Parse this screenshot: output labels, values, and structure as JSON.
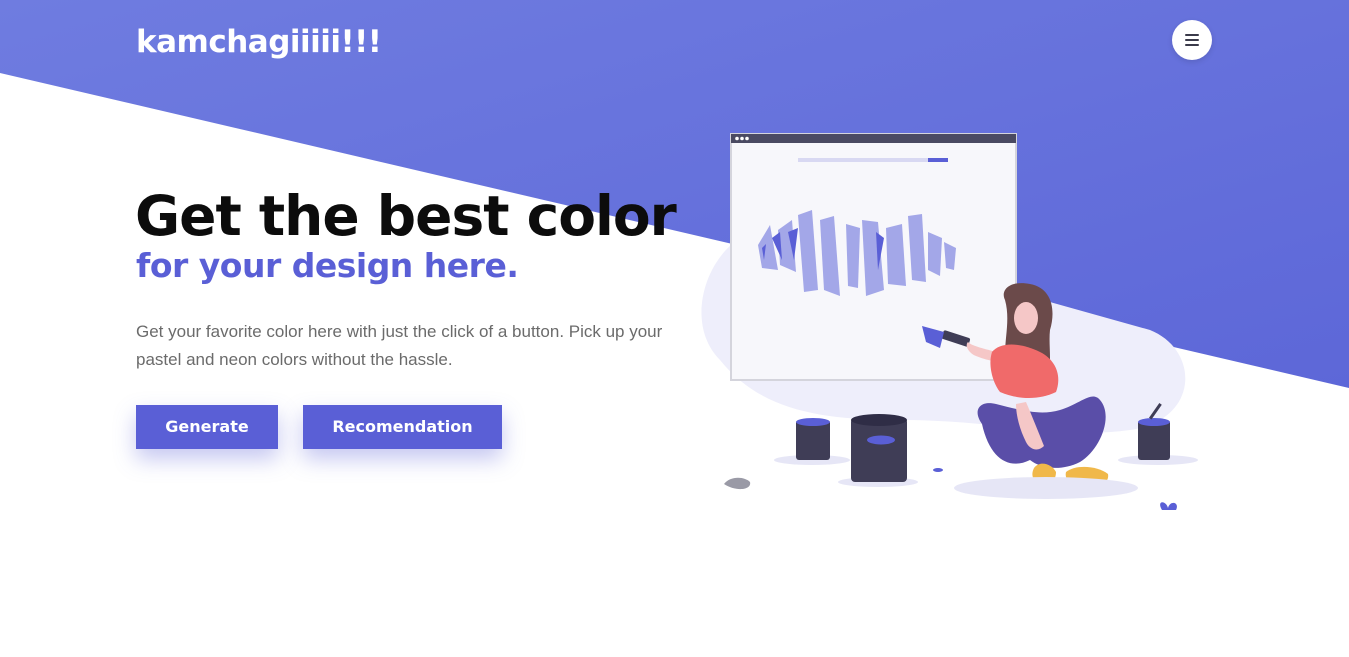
{
  "header": {
    "logo_text": "kamchagiiiii!!!",
    "menu_icon": "hamburger-menu-icon"
  },
  "hero": {
    "headline": "Get the best color",
    "subheadline": "for your design here.",
    "description": "Get your favorite color here with just the click of a button. Pick up your pastel and neon colors without the hassle.",
    "buttons": {
      "generate_label": "Generate",
      "recommend_label": "Recomendation"
    }
  },
  "illustration": {
    "icon": "woman-painting-canvas-illustration"
  },
  "colors": {
    "accent": "#5a5fd6",
    "accent_light": "#6d76e0",
    "headline": "#0c0c0c",
    "body_text": "#6b6b6b",
    "background": "#ffffff"
  }
}
